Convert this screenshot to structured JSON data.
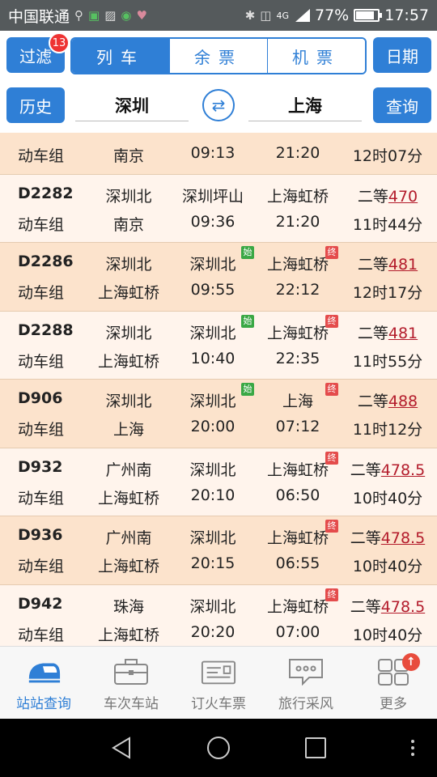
{
  "status_bar": {
    "carrier": "中国联通",
    "network": "4G",
    "battery": "77%",
    "battery_level": 0.77,
    "time": "17:57"
  },
  "header": {
    "filter_label": "过滤",
    "filter_badge": "13",
    "tabs": [
      {
        "label": "列车",
        "active": true
      },
      {
        "label": "余票",
        "active": false
      },
      {
        "label": "机票",
        "active": false
      }
    ],
    "date_label": "日期",
    "history_label": "历史",
    "from_station": "深圳",
    "to_station": "上海",
    "swap_icon": "swap-icon",
    "query_label": "查询"
  },
  "trains": [
    {
      "code": "",
      "type": "动车组",
      "origin": "",
      "dest_terminal": "南京",
      "depart_station": "",
      "start": false,
      "arrive_station": "",
      "end": false,
      "depart_time": "09:13",
      "arrive_time": "21:20",
      "seat": "",
      "price": "",
      "duration": "12时07分"
    },
    {
      "code": "D2282",
      "type": "动车组",
      "origin": "深圳北",
      "dest_terminal": "南京",
      "depart_station": "深圳坪山",
      "start": false,
      "arrive_station": "上海虹桥",
      "end": false,
      "depart_time": "09:36",
      "arrive_time": "21:20",
      "seat": "二等",
      "price": "470",
      "duration": "11时44分"
    },
    {
      "code": "D2286",
      "type": "动车组",
      "origin": "深圳北",
      "dest_terminal": "上海虹桥",
      "depart_station": "深圳北",
      "start": true,
      "arrive_station": "上海虹桥",
      "end": true,
      "depart_time": "09:55",
      "arrive_time": "22:12",
      "seat": "二等",
      "price": "481",
      "duration": "12时17分"
    },
    {
      "code": "D2288",
      "type": "动车组",
      "origin": "深圳北",
      "dest_terminal": "上海虹桥",
      "depart_station": "深圳北",
      "start": true,
      "arrive_station": "上海虹桥",
      "end": true,
      "depart_time": "10:40",
      "arrive_time": "22:35",
      "seat": "二等",
      "price": "481",
      "duration": "11时55分"
    },
    {
      "code": "D906",
      "type": "动车组",
      "origin": "深圳北",
      "dest_terminal": "上海",
      "depart_station": "深圳北",
      "start": true,
      "arrive_station": "上海",
      "end": true,
      "depart_time": "20:00",
      "arrive_time": "07:12",
      "seat": "二等",
      "price": "488",
      "duration": "11时12分"
    },
    {
      "code": "D932",
      "type": "动车组",
      "origin": "广州南",
      "dest_terminal": "上海虹桥",
      "depart_station": "深圳北",
      "start": false,
      "arrive_station": "上海虹桥",
      "end": true,
      "depart_time": "20:10",
      "arrive_time": "06:50",
      "seat": "二等",
      "price": "478.5",
      "duration": "10时40分"
    },
    {
      "code": "D936",
      "type": "动车组",
      "origin": "广州南",
      "dest_terminal": "上海虹桥",
      "depart_station": "深圳北",
      "start": false,
      "arrive_station": "上海虹桥",
      "end": true,
      "depart_time": "20:15",
      "arrive_time": "06:55",
      "seat": "二等",
      "price": "478.5",
      "duration": "10时40分"
    },
    {
      "code": "D942",
      "type": "动车组",
      "origin": "珠海",
      "dest_terminal": "上海虹桥",
      "depart_station": "深圳北",
      "start": false,
      "arrive_station": "上海虹桥",
      "end": true,
      "depart_time": "20:20",
      "arrive_time": "07:00",
      "seat": "二等",
      "price": "478.5",
      "duration": "10时40分"
    }
  ],
  "tags": {
    "start": "始",
    "end": "终"
  },
  "tabbar": [
    {
      "label": "站站查询",
      "icon": "train-icon",
      "active": true
    },
    {
      "label": "车次车站",
      "icon": "briefcase-icon",
      "active": false
    },
    {
      "label": "订火车票",
      "icon": "ticket-icon",
      "active": false
    },
    {
      "label": "旅行采风",
      "icon": "chat-icon",
      "active": false
    },
    {
      "label": "更多",
      "icon": "grid-icon",
      "active": false,
      "badge": "↑"
    }
  ],
  "colors": {
    "accent": "#2f7fd6",
    "row_odd": "#fce3cc",
    "row_even": "#fff4ec",
    "price": "#b31b2b",
    "start_tag": "#3aa845",
    "end_tag": "#e44c4c"
  }
}
